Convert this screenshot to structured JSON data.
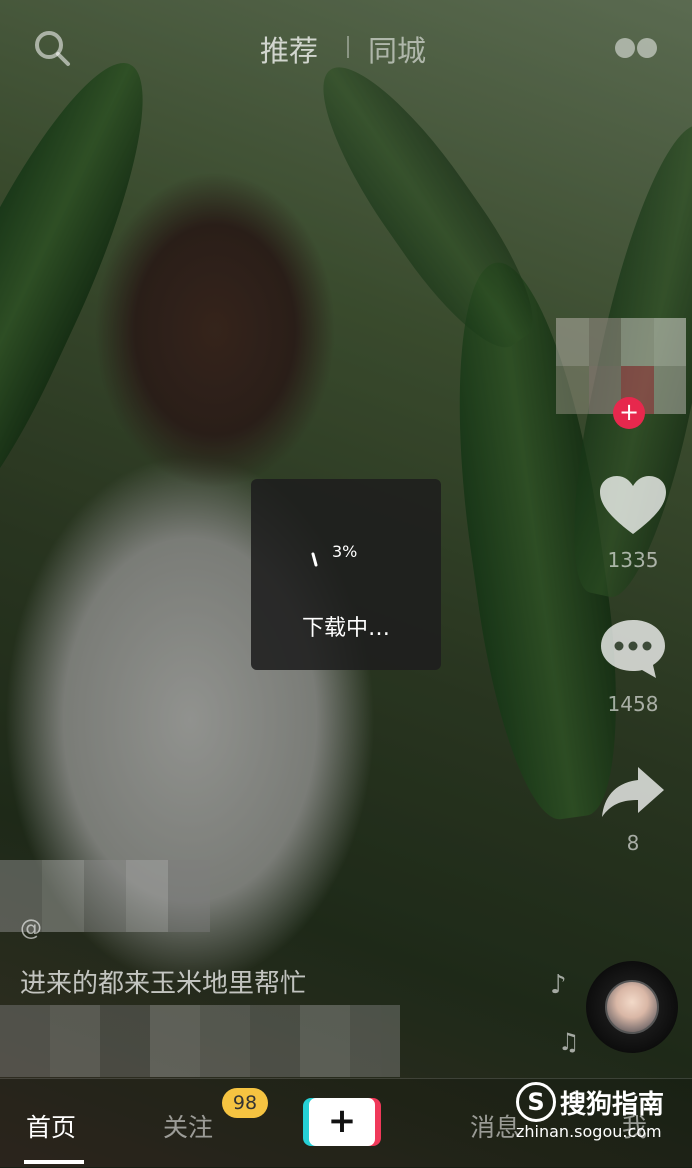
{
  "header": {
    "tabs": [
      {
        "label": "推荐"
      },
      {
        "label": "同城"
      }
    ]
  },
  "actions": {
    "likes": "1335",
    "comments": "1458",
    "shares": "8"
  },
  "toast": {
    "percent": "3%",
    "message": "下载中…"
  },
  "video": {
    "author": "@",
    "caption": "进来的都来玉米地里帮忙"
  },
  "bottom_nav": {
    "items": [
      {
        "label": "首页"
      },
      {
        "label": "关注"
      },
      {
        "label": "消息"
      },
      {
        "label": "我"
      }
    ],
    "follow_badge": "98",
    "plus": "+"
  },
  "watermark": {
    "logo": "S",
    "title": "搜狗指南",
    "url": "zhinan.sogou.com"
  },
  "colors": {
    "like_red": "#e7284d",
    "badge_yellow": "#f5c341",
    "plus_cyan": "#26d0d6",
    "plus_pink": "#f0395a"
  },
  "icons": [
    "search-icon",
    "live-icon",
    "heart-icon",
    "comment-icon",
    "share-icon",
    "music-note-icon",
    "music-disc-icon"
  ]
}
